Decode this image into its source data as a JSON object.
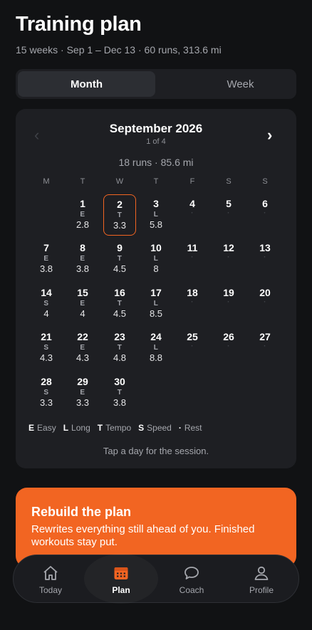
{
  "header": {
    "title": "Training plan",
    "subtitle": "15 weeks · Sep 1 – Dec 13 · 60 runs, 313.6 mi"
  },
  "view_toggle": {
    "month": "Month",
    "week": "Week",
    "selected": "Month"
  },
  "calendar": {
    "month_title": "September 2026",
    "month_index": "1 of 4",
    "summary": "18 runs · 85.6 mi",
    "prev_icon": "‹",
    "next_icon": "›",
    "weekdays": [
      "M",
      "T",
      "W",
      "T",
      "F",
      "S",
      "S"
    ],
    "days": [
      {
        "num": "1",
        "code": "E",
        "dist": "2.8"
      },
      {
        "num": "2",
        "code": "T",
        "dist": "3.3",
        "selected": true
      },
      {
        "num": "3",
        "code": "L",
        "dist": "5.8"
      },
      {
        "num": "4",
        "code": "·",
        "dist": ""
      },
      {
        "num": "5",
        "code": "·",
        "dist": ""
      },
      {
        "num": "6",
        "code": "·",
        "dist": ""
      },
      {
        "num": "7",
        "code": "E",
        "dist": "3.8"
      },
      {
        "num": "8",
        "code": "E",
        "dist": "3.8"
      },
      {
        "num": "9",
        "code": "T",
        "dist": "4.5"
      },
      {
        "num": "10",
        "code": "L",
        "dist": "8"
      },
      {
        "num": "11",
        "code": "·",
        "dist": ""
      },
      {
        "num": "12",
        "code": "·",
        "dist": ""
      },
      {
        "num": "13",
        "code": "·",
        "dist": ""
      },
      {
        "num": "14",
        "code": "S",
        "dist": "4"
      },
      {
        "num": "15",
        "code": "E",
        "dist": "4"
      },
      {
        "num": "16",
        "code": "T",
        "dist": "4.5"
      },
      {
        "num": "17",
        "code": "L",
        "dist": "8.5"
      },
      {
        "num": "18",
        "code": "·",
        "dist": ""
      },
      {
        "num": "19",
        "code": "·",
        "dist": ""
      },
      {
        "num": "20",
        "code": "·",
        "dist": ""
      },
      {
        "num": "21",
        "code": "S",
        "dist": "4.3"
      },
      {
        "num": "22",
        "code": "E",
        "dist": "4.3"
      },
      {
        "num": "23",
        "code": "T",
        "dist": "4.8"
      },
      {
        "num": "24",
        "code": "L",
        "dist": "8.8"
      },
      {
        "num": "25",
        "code": "·",
        "dist": ""
      },
      {
        "num": "26",
        "code": "·",
        "dist": ""
      },
      {
        "num": "27",
        "code": "·",
        "dist": ""
      },
      {
        "num": "28",
        "code": "S",
        "dist": "3.3"
      },
      {
        "num": "29",
        "code": "E",
        "dist": "3.3"
      },
      {
        "num": "30",
        "code": "T",
        "dist": "3.8"
      }
    ],
    "legend": [
      {
        "key": "E",
        "label": "Easy"
      },
      {
        "key": "L",
        "label": "Long"
      },
      {
        "key": "T",
        "label": "Tempo"
      },
      {
        "key": "S",
        "label": "Speed"
      },
      {
        "key": "·",
        "label": "Rest"
      }
    ],
    "hint": "Tap a day for the session."
  },
  "rebuild": {
    "title": "Rebuild the plan",
    "description": "Rewrites everything still ahead of you. Finished workouts stay put."
  },
  "tabbar": {
    "items": [
      {
        "label": "Today",
        "icon": "home-icon"
      },
      {
        "label": "Plan",
        "icon": "calendar-icon",
        "active": true
      },
      {
        "label": "Coach",
        "icon": "chat-bubble-icon"
      },
      {
        "label": "Profile",
        "icon": "person-icon"
      }
    ]
  },
  "colors": {
    "accent": "#f26522",
    "background": "#111214",
    "card": "#1e1f23"
  }
}
